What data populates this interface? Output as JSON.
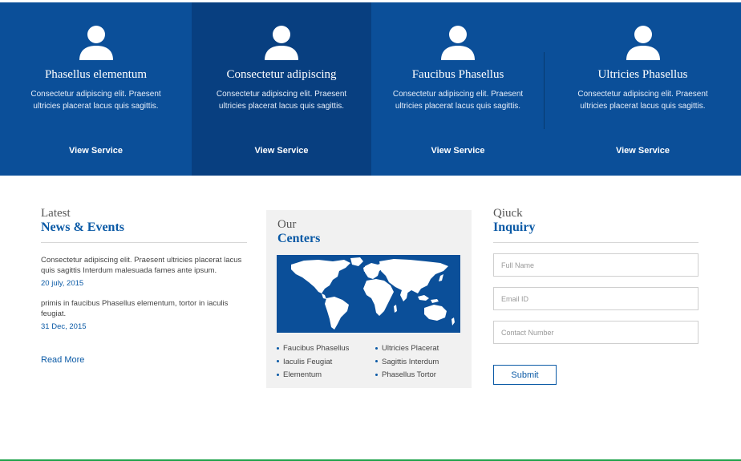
{
  "services": [
    {
      "title": "Phasellus elementum",
      "text": "Consectetur adipiscing elit. Praesent ultricies placerat lacus quis sagittis.",
      "link": "View Service",
      "icon": "user-icon"
    },
    {
      "title": "Consectetur adipiscing",
      "text": "Consectetur adipiscing elit. Praesent ultricies placerat lacus quis sagittis.",
      "link": "View Service",
      "icon": "user-icon"
    },
    {
      "title": "Faucibus Phasellus",
      "text": "Consectetur adipiscing elit. Praesent ultricies placerat lacus quis sagittis.",
      "link": "View Service",
      "icon": "user-icon"
    },
    {
      "title": "Ultricies Phasellus",
      "text": "Consectetur adipiscing elit. Praesent ultricies placerat lacus quis sagittis.",
      "link": "View Service",
      "icon": "user-icon"
    }
  ],
  "news": {
    "heading_light": "Latest",
    "heading_bold": "News & Events",
    "items": [
      {
        "text": "Consectetur adipiscing elit. Praesent ultricies placerat lacus quis sagittis Interdum malesuada fames ante ipsum.",
        "date": "20 july, 2015"
      },
      {
        "text": "primis in faucibus Phasellus elementum, tortor in iaculis feugiat.",
        "date": "31 Dec, 2015"
      }
    ],
    "read_more": "Read More"
  },
  "centers": {
    "heading_light": "Our",
    "heading_bold": "Centers",
    "map_icon": "world-map",
    "left": [
      "Faucibus Phasellus",
      "Iaculis Feugiat",
      "Elementum"
    ],
    "right": [
      "Ultricies Placerat",
      "Sagittis Interdum",
      "Phasellus Tortor"
    ]
  },
  "inquiry": {
    "heading_light": "Qiuck",
    "heading_bold": "Inquiry",
    "fields": [
      {
        "placeholder": "Full Name"
      },
      {
        "placeholder": "Email ID"
      },
      {
        "placeholder": "Contact Number"
      }
    ],
    "submit_label": "Submit"
  },
  "colors": {
    "primary": "#0b4f99",
    "primary_dark": "#083f80",
    "accent": "#0b5aa6",
    "footer_line": "#1fa34a"
  }
}
